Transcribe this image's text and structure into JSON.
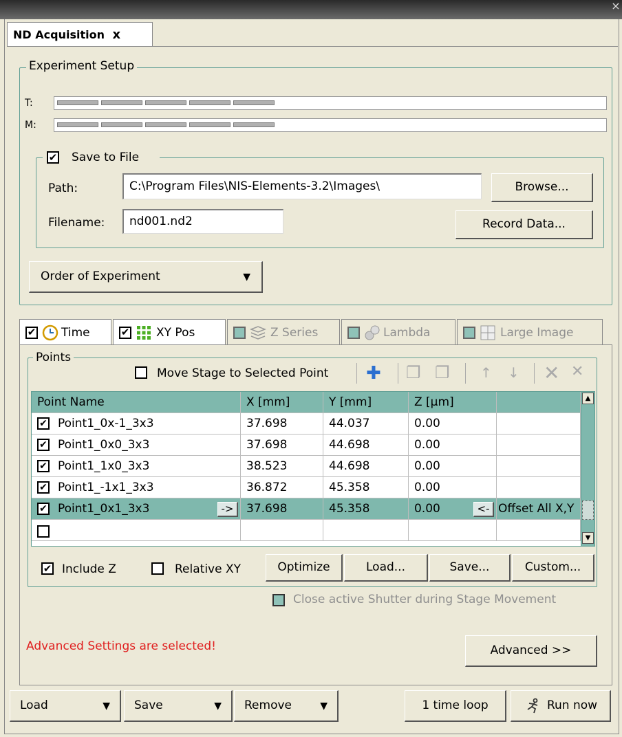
{
  "window": {
    "close_glyph": "×"
  },
  "tab": {
    "label": "ND Acquisition",
    "close_glyph": "x"
  },
  "experiment_setup": {
    "legend": "Experiment Setup",
    "t_label": "T:",
    "m_label": "M:"
  },
  "save_to_file": {
    "legend": "Save to File",
    "checked": true,
    "path_label": "Path:",
    "path_value": "C:\\Program Files\\NIS-Elements-3.2\\Images\\",
    "browse_label": "Browse...",
    "filename_label": "Filename:",
    "filename_value": "nd001.nd2",
    "record_label": "Record Data..."
  },
  "order_dropdown": {
    "label": "Order of Experiment"
  },
  "tabs": [
    {
      "label": "Time",
      "checked": true,
      "icon": "clock-icon",
      "active": true
    },
    {
      "label": "XY Pos",
      "checked": true,
      "icon": "grid-icon",
      "active": true
    },
    {
      "label": "Z Series",
      "checked": false,
      "icon": "layers-icon",
      "active": false
    },
    {
      "label": "Lambda",
      "checked": false,
      "icon": "lambda-icon",
      "active": false
    },
    {
      "label": "Large Image",
      "checked": false,
      "icon": "large-image-icon",
      "active": false
    }
  ],
  "points": {
    "legend": "Points",
    "move_stage_label": "Move Stage to Selected Point",
    "columns": [
      "Point Name",
      "X [mm]",
      "Y [mm]",
      "Z [µm]",
      ""
    ],
    "rows": [
      {
        "name": "Point1_0x-1_3x3",
        "x": "37.698",
        "y": "44.037",
        "z": "0.00",
        "checked": true
      },
      {
        "name": "Point1_0x0_3x3",
        "x": "37.698",
        "y": "44.698",
        "z": "0.00",
        "checked": true
      },
      {
        "name": "Point1_1x0_3x3",
        "x": "38.523",
        "y": "44.698",
        "z": "0.00",
        "checked": true
      },
      {
        "name": "Point1_-1x1_3x3",
        "x": "36.872",
        "y": "45.358",
        "z": "0.00",
        "checked": true
      },
      {
        "name": "Point1_0x1_3x3",
        "x": "37.698",
        "y": "45.358",
        "z": "0.00",
        "checked": true,
        "selected": true,
        "go_label": "->",
        "back_label": "<-",
        "extra": "Offset All X,Y"
      }
    ],
    "include_z_label": "Include Z",
    "include_z_checked": true,
    "relative_xy_label": "Relative XY",
    "relative_xy_checked": false,
    "optimize_label": "Optimize",
    "load_label": "Load...",
    "save_label": "Save...",
    "custom_label": "Custom..."
  },
  "shutter_label": "Close active Shutter during Stage Movement",
  "advanced_warning": "Advanced Settings are selected!",
  "advanced_button": "Advanced >>",
  "bottom": {
    "load": "Load",
    "save": "Save",
    "remove": "Remove",
    "loop": "1 time loop",
    "run": "Run now"
  },
  "colors": {
    "accent": "#7fb8ad",
    "warning": "#e02020",
    "background": "#ece9d8"
  }
}
